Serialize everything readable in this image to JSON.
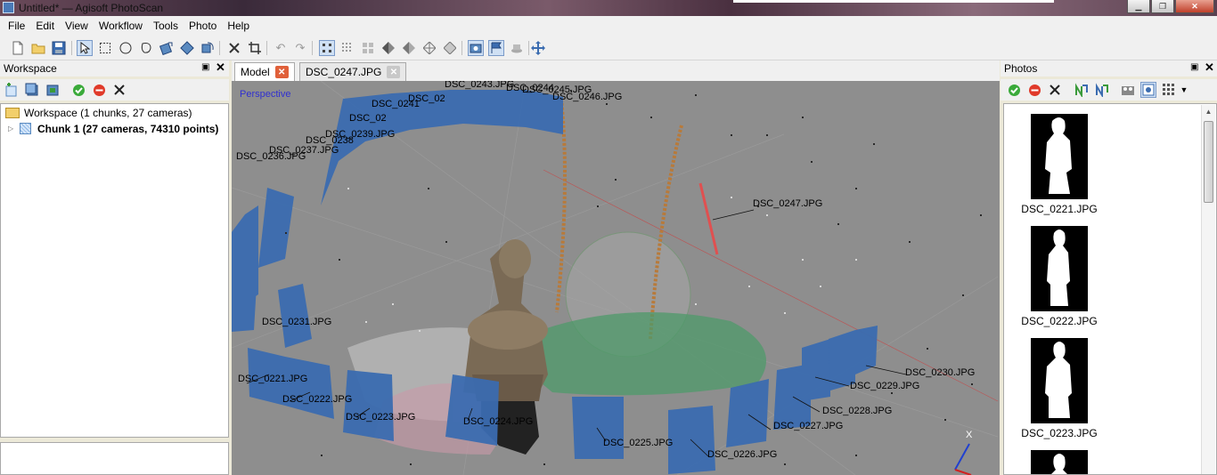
{
  "window": {
    "title": "Untitled* — Agisoft PhotoScan",
    "minimize": "▁",
    "maximize": "❐",
    "close": "✕"
  },
  "menu": [
    "File",
    "Edit",
    "View",
    "Workflow",
    "Tools",
    "Photo",
    "Help"
  ],
  "toolbar_icons": [
    "new-icon",
    "open-icon",
    "save-icon",
    "pointer-icon",
    "rect-select-icon",
    "circle-select-icon",
    "free-select-icon",
    "move-region-icon",
    "resize-region-icon",
    "rotate-region-icon",
    "delete-icon",
    "crop-icon",
    "undo-icon",
    "redo-icon",
    "point-cloud-icon",
    "dense-cloud-icon",
    "tiled-icon",
    "shaded-icon",
    "solid-icon",
    "wireframe-icon",
    "textured-icon",
    "show-cameras-icon",
    "show-shapes-icon",
    "show-region-icon",
    "navigation-icon"
  ],
  "workspace": {
    "title": "Workspace",
    "root_label": "Workspace (1 chunks, 27 cameras)",
    "chunk_label": "Chunk 1 (27 cameras, 74310 points)"
  },
  "tabs": [
    {
      "label": "Model",
      "active": true
    },
    {
      "label": "DSC_0247.JPG",
      "active": false
    }
  ],
  "viewport": {
    "projection": "Perspective",
    "axis_label": "X",
    "camera_labels": [
      "DSC_0243.JPG",
      "DSC_0244",
      "DSC_0245.JPG",
      "DSC_0246.JPG",
      "DSC_02",
      "DSC_0241",
      "DSC_02",
      "DSC_0239.JPG",
      "DSC_0238",
      "DSC_0237.JPG",
      "DSC_0236.JPG",
      "DSC_0247.JPG",
      "DSC_0231.JPG",
      "DSC_0221.JPG",
      "DSC_0222.JPG",
      "DSC_0223.JPG",
      "DSC_0224.JPG",
      "DSC_0225.JPG",
      "DSC_0226.JPG",
      "DSC_0227.JPG",
      "DSC_0228.JPG",
      "DSC_0229.JPG",
      "DSC_0230.JPG"
    ]
  },
  "photos": {
    "title": "Photos",
    "items": [
      {
        "label": "DSC_0221.JPG"
      },
      {
        "label": "DSC_0222.JPG"
      },
      {
        "label": "DSC_0223.JPG"
      },
      {
        "label": ""
      }
    ]
  },
  "colors": {
    "accent": "#3b6cb0",
    "viewport_bg": "#8e8e8e",
    "tab_close_active": "#e0603a"
  }
}
